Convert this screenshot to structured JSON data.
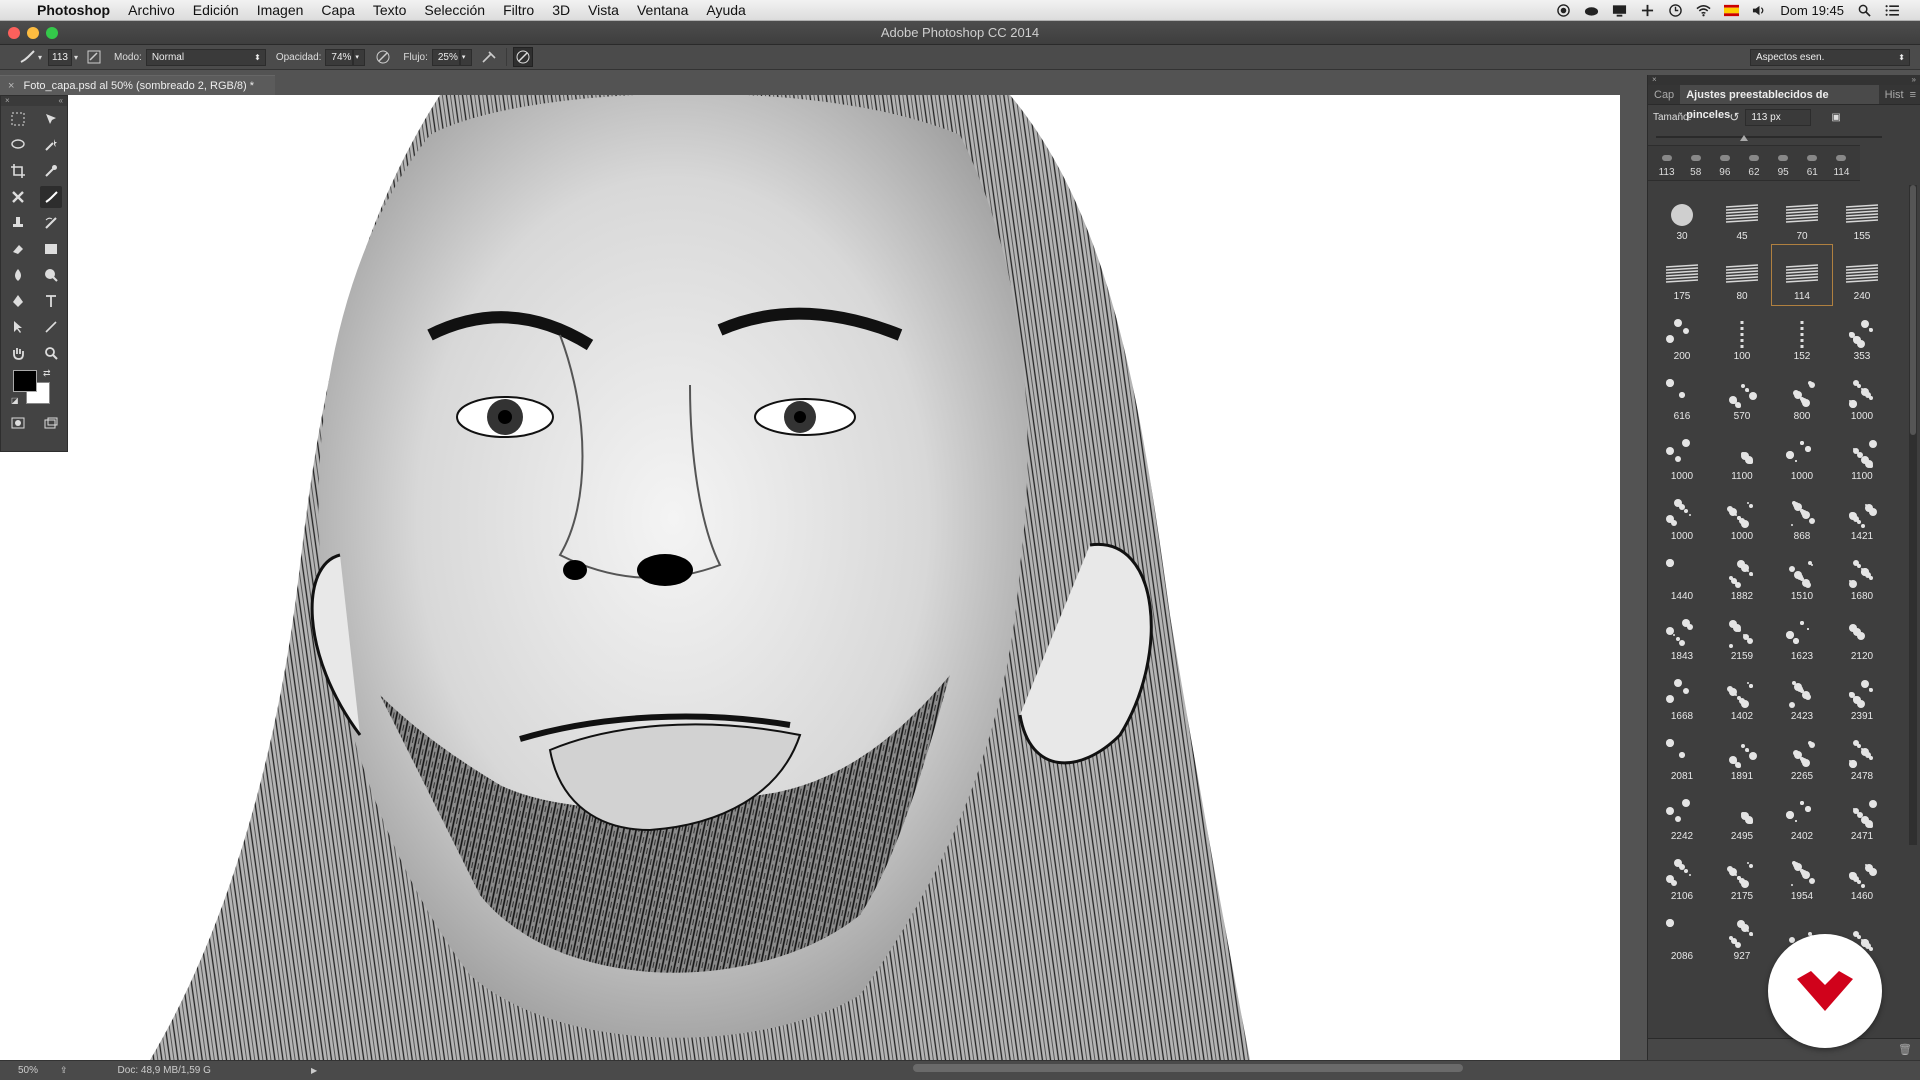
{
  "menubar": {
    "app_name": "Photoshop",
    "menus": [
      "Archivo",
      "Edición",
      "Imagen",
      "Capa",
      "Texto",
      "Selección",
      "Filtro",
      "3D",
      "Vista",
      "Ventana",
      "Ayuda"
    ],
    "clock": "Dom 19:45"
  },
  "window": {
    "title": "Adobe Photoshop CC 2014"
  },
  "options": {
    "brush_size": "113",
    "mode_label": "Modo:",
    "mode_value": "Normal",
    "opacity_label": "Opacidad:",
    "opacity_value": "74%",
    "flow_label": "Flujo:",
    "flow_value": "25%",
    "workspace": "Aspectos esen."
  },
  "document": {
    "tab_title": "Foto_capa.psd al 50% (sombreado 2, RGB/8) *"
  },
  "status": {
    "zoom": "50%",
    "doc": "Doc: 48,9 MB/1,59 G"
  },
  "panel": {
    "tabs": [
      "Cap",
      "Ajustes preestablecidos de pinceles",
      "Hist"
    ],
    "size_label": "Tamaño:",
    "size_value": "113 px",
    "recent": [
      "113",
      "58",
      "96",
      "62",
      "95",
      "61",
      "114"
    ],
    "presets": [
      "30",
      "45",
      "70",
      "155",
      "175",
      "80",
      "114",
      "240",
      "200",
      "100",
      "152",
      "353",
      "616",
      "570",
      "800",
      "1000",
      "1000",
      "1100",
      "1000",
      "1100",
      "1000",
      "1000",
      "868",
      "1421",
      "1440",
      "1882",
      "1510",
      "1680",
      "1843",
      "2159",
      "1623",
      "2120",
      "1668",
      "1402",
      "2423",
      "2391",
      "2081",
      "1891",
      "2265",
      "2478",
      "2242",
      "2495",
      "2402",
      "2471",
      "2106",
      "2175",
      "1954",
      "1460",
      "2086",
      "927",
      "",
      ""
    ],
    "selected_preset_index": 6
  },
  "colors": {
    "accent_logo": "#d0021b",
    "foreground": "#000000",
    "background": "#ffffff"
  }
}
